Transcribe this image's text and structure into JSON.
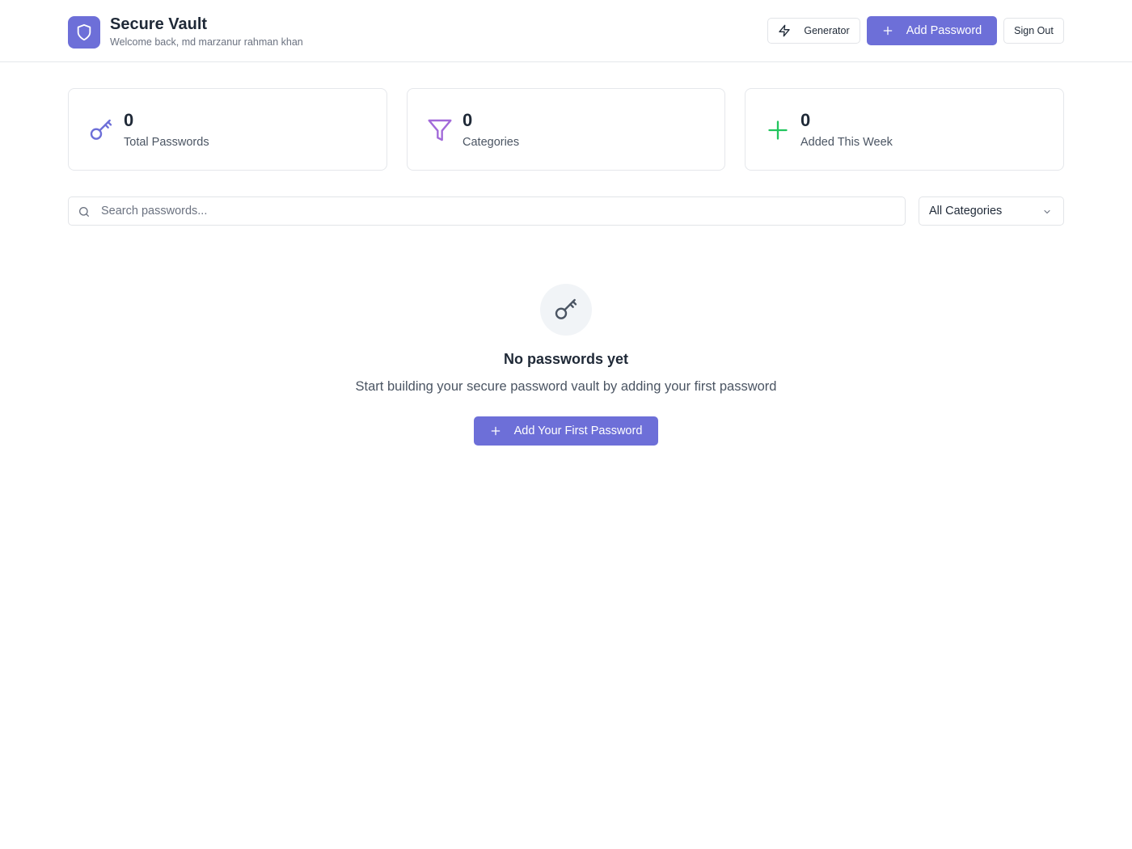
{
  "header": {
    "title": "Secure Vault",
    "subtitle": "Welcome back, md marzanur rahman khan",
    "logo_icon": "shield-icon",
    "generator_label": "Generator",
    "add_label": "Add Password",
    "signout_label": "Sign Out"
  },
  "stats": [
    {
      "value": "0",
      "label": "Total Passwords",
      "icon": "key-icon",
      "color": "#6d6fd8"
    },
    {
      "value": "0",
      "label": "Categories",
      "icon": "filter-icon",
      "color": "#a26ad9"
    },
    {
      "value": "0",
      "label": "Added This Week",
      "icon": "plus-icon",
      "color": "#22c55e"
    }
  ],
  "search": {
    "placeholder": "Search passwords...",
    "value": ""
  },
  "filter": {
    "selected": "All Categories"
  },
  "empty_state": {
    "title": "No passwords yet",
    "text": "Start building your secure password vault by adding your first password",
    "button_label": "Add Your First Password"
  },
  "colors": {
    "primary": "#6d6fd8",
    "border": "#e5e7eb",
    "muted_text": "#6b7280"
  }
}
